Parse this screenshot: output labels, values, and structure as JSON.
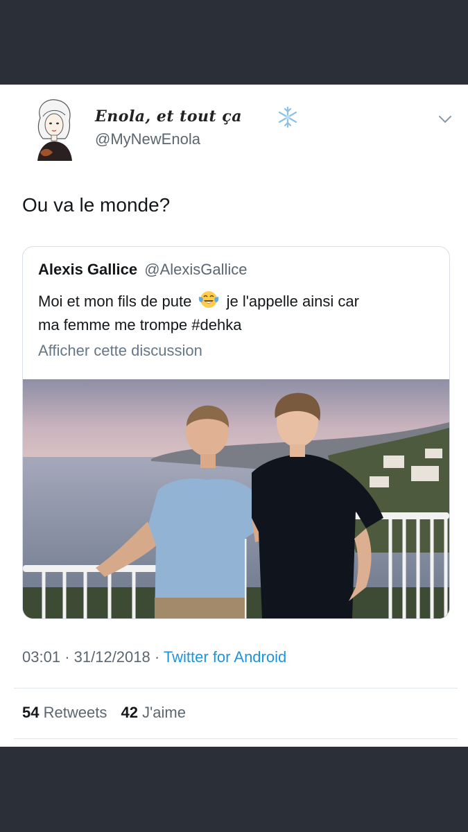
{
  "author": {
    "display_name": "Enola, et tout ça",
    "handle": "@MyNewEnola",
    "avatar_icon": "cartoon-girl-avatar",
    "name_suffix_icon": "snowflake-icon"
  },
  "tweet": {
    "text": "Ou va le monde?"
  },
  "quoted_tweet": {
    "author_name": "Alexis Gallice",
    "author_handle": "@AlexisGallice",
    "text_line1_before_emoji": "Moi et mon fils de pute",
    "emoji": "face-with-tears-of-joy",
    "text_line1_after_emoji": "je l'appelle ainsi car",
    "text_line2": "ma femme me trompe #dehka",
    "show_thread_link": "Afficher cette discussion"
  },
  "meta": {
    "time": "03:01",
    "date": "31/12/2018",
    "source": "Twitter for Android",
    "separator": "·"
  },
  "stats": {
    "retweets_count": "54",
    "retweets_label": "Retweets",
    "likes_count": "42",
    "likes_label": "J'aime"
  },
  "colors": {
    "background": "#2b2f37",
    "card": "#ffffff",
    "link_blue": "#1b95e0",
    "secondary_text": "#5b6670"
  }
}
